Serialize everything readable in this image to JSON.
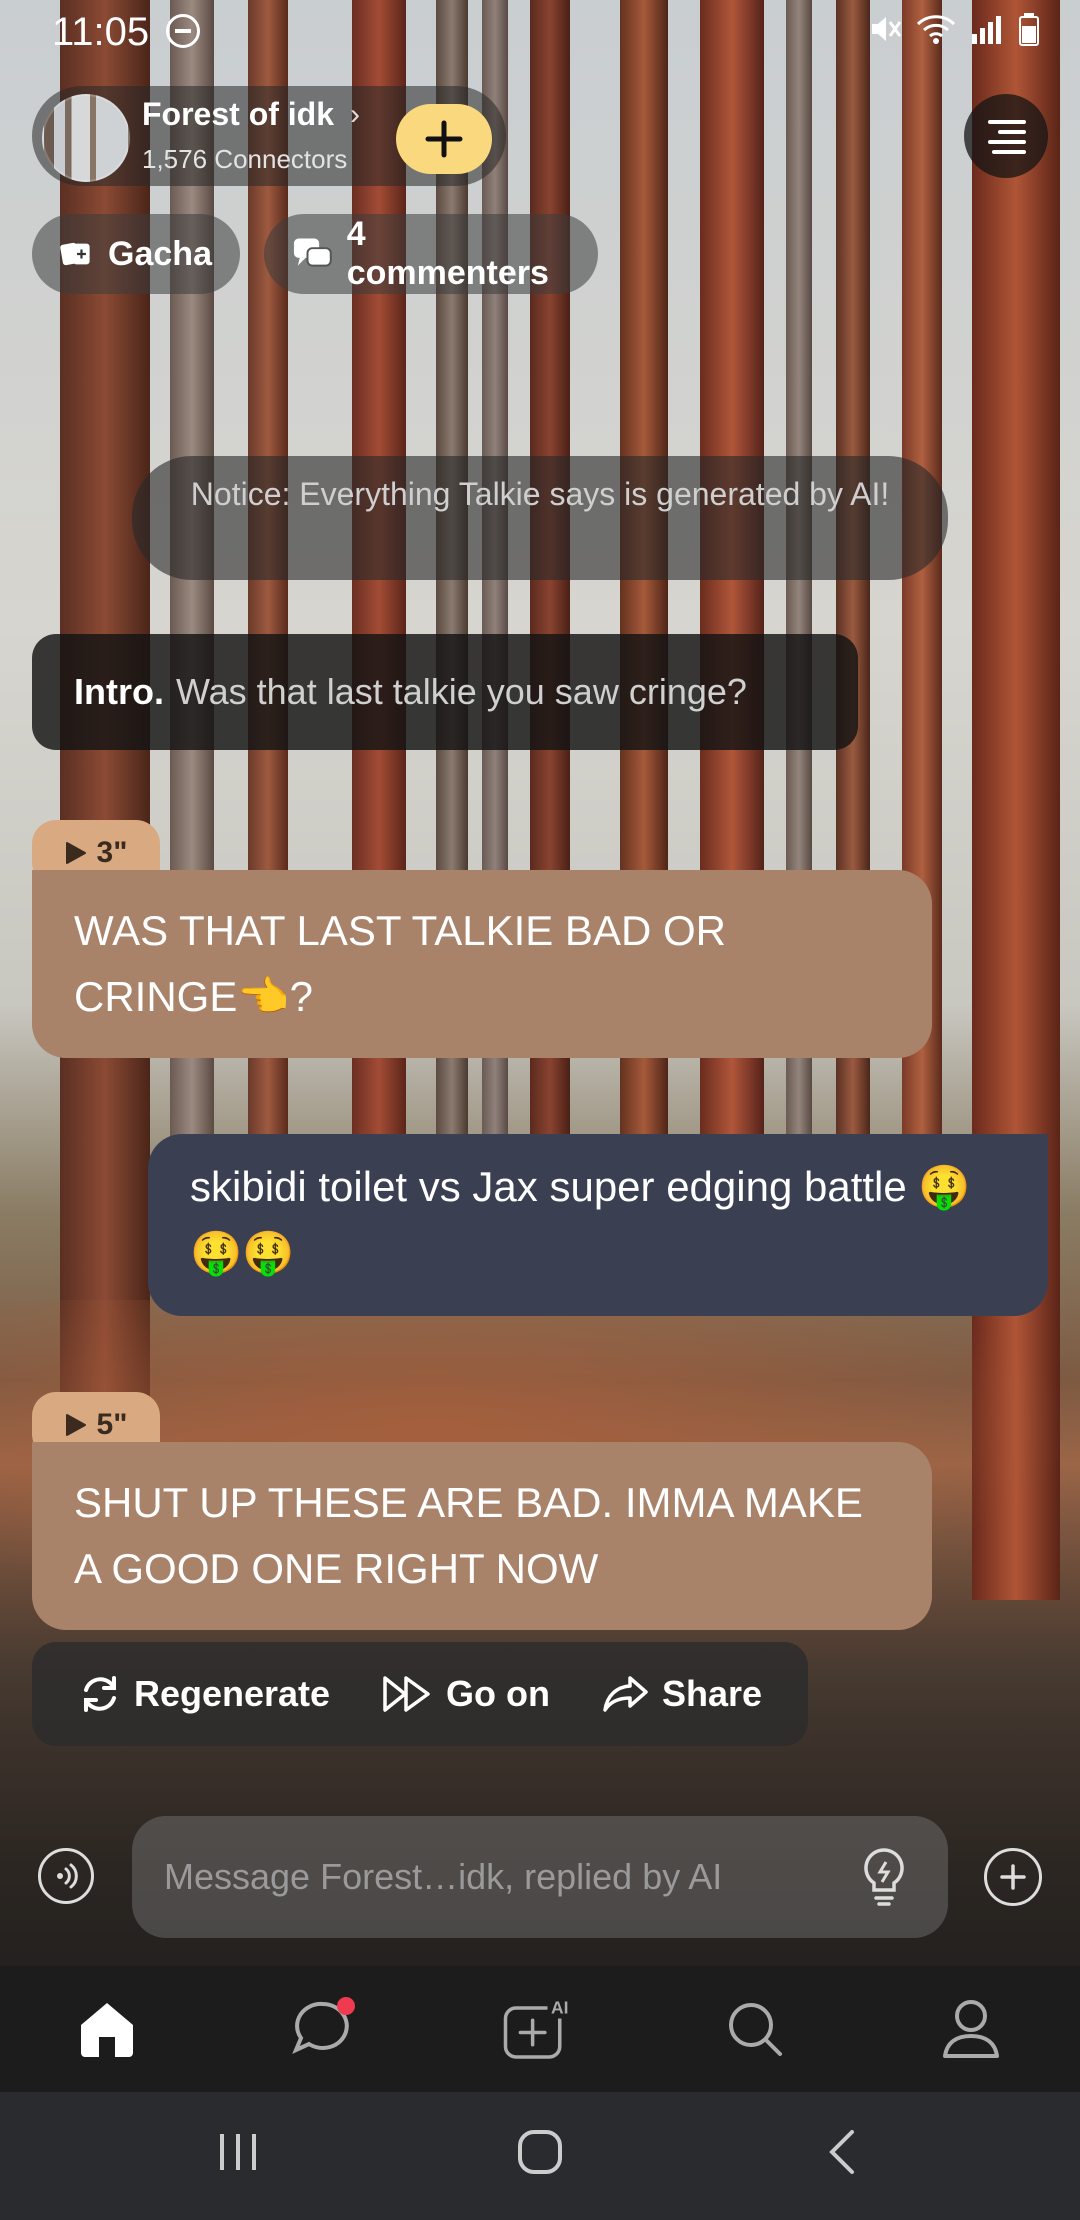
{
  "status_bar": {
    "time": "11:05"
  },
  "header": {
    "room_name": "Forest of idk",
    "connectors": "1,576 Connectors"
  },
  "chips": {
    "gacha": "Gacha",
    "commenters": "4 commenters"
  },
  "notice": "Notice: Everything Talkie says is generated by AI!",
  "intro": {
    "label": "Intro.",
    "text": "Was that last talkie you saw cringe?"
  },
  "messages": [
    {
      "sender": "ai",
      "duration": "3\"",
      "text": "WAS THAT LAST TALKIE BAD OR CRINGE👈?"
    },
    {
      "sender": "user",
      "text": "skibidi toilet vs Jax super edging battle 🤑🤑🤑"
    },
    {
      "sender": "ai",
      "duration": "5\"",
      "text": "SHUT UP  THESE ARE BAD. IMMA MAKE A GOOD ONE RIGHT NOW"
    }
  ],
  "actions": {
    "regenerate": "Regenerate",
    "go_on": "Go on",
    "share": "Share"
  },
  "composer": {
    "placeholder": "Message Forest…idk, replied by AI"
  },
  "tabbar": {
    "ai_badge": "AI"
  },
  "colors": {
    "accent_yellow": "#f9d87e",
    "ai_bubble": "#a9826a",
    "user_bubble": "#3a3f52",
    "notification_dot": "#ef3a4f"
  }
}
